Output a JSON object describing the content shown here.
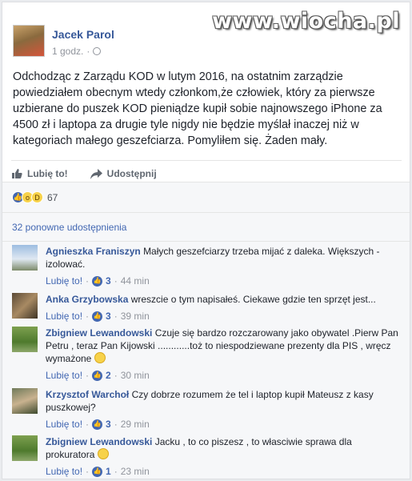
{
  "watermark": "www.wiocha.pl",
  "post": {
    "author": "Jacek Parol",
    "time": "1 godz.",
    "text": "Odchodząc z Zarządu KOD w lutym 2016, na ostatnim zarządzie powiedziałem obecnym wtedy członkom,że człowiek, który za pierwsze uzbierane do puszek KOD pieniądze kupił sobie najnowszego iPhone za 4500 zł i laptopa za drugie tyle nigdy nie będzie myślał inaczej niż w kategoriach małego geszefciarza. Pomyliłem się. Żaden mały.",
    "like_label": "Lubię to!",
    "share_label": "Udostępnij",
    "reactions_count": "67",
    "shares_text": "32 ponowne udostępnienia"
  },
  "comments": [
    {
      "author": "Agnieszka Franiszyn",
      "text": "Małych geszefciarzy trzeba mijać z daleka. Większych - izolować.",
      "like_label": "Lubię to!",
      "likes": "3",
      "time": "44 min",
      "emoji": false
    },
    {
      "author": "Anka Grzybowska",
      "text": "wreszcie o tym napisałeś. Ciekawe gdzie ten sprzęt jest...",
      "like_label": "Lubię to!",
      "likes": "3",
      "time": "39 min",
      "emoji": false
    },
    {
      "author": "Zbigniew Lewandowski",
      "text": "Czuje się bardzo rozczarowany jako obywatel .Pierw Pan Petru , teraz Pan Kijowski ............toż to niespodziewane prezenty dla PIS , wręcz wymażone",
      "like_label": "Lubię to!",
      "likes": "2",
      "time": "30 min",
      "emoji": true
    },
    {
      "author": "Krzysztof Warchoł",
      "text": "Czy dobrze rozumem że tel i laptop kupił Mateusz z kasy puszkowej?",
      "like_label": "Lubię to!",
      "likes": "3",
      "time": "29 min",
      "emoji": false
    },
    {
      "author": "Zbigniew Lewandowski",
      "text": "Jacku , to co piszesz , to własciwie sprawa dla prokuratora",
      "like_label": "Lubię to!",
      "likes": "1",
      "time": "23 min",
      "emoji": true
    }
  ],
  "colors": {
    "link": "#365899",
    "accent": "#4267b2",
    "muted": "#90949c"
  }
}
